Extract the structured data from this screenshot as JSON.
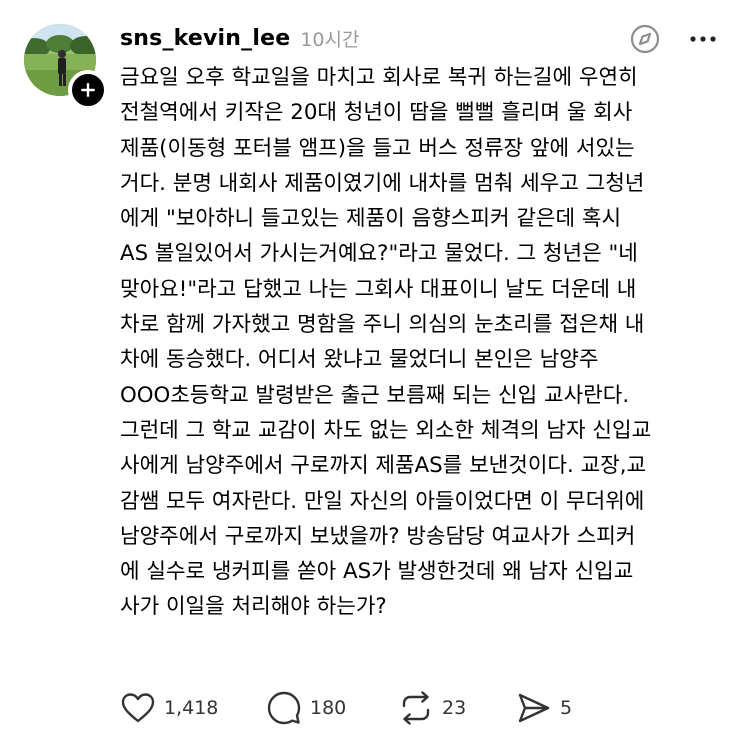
{
  "post": {
    "username": "sns_kevin_lee",
    "timestamp": "10시간",
    "body_lines": [
      "금요일 오후 학교일을 마치고 회사로 복귀 하는길에 우연히",
      "전철역에서 키작은 20대 청년이 땀을 뻘뻘 흘리며 울 회사",
      "제품(이동형 포터블 앰프)을 들고 버스 정류장 앞에 서있는",
      "거다. 분명 내회사 제품이였기에 내차를 멈춰 세우고 그청년",
      "에게 \"보아하니 들고있는 제품이 음향스피커 같은데 혹시",
      "AS 볼일있어서 가시는거예요?\"라고 물었다. 그 청년은 \"네",
      "맞아요!\"라고 답했고 나는 그회사 대표이니 날도 더운데 내",
      "차로 함께 가자했고 명함을 주니 의심의 눈초리를 접은채 내",
      "차에 동승했다. 어디서 왔냐고 물었더니 본인은 남양주",
      "OOO초등학교 발령받은 출근 보름째 되는 신입 교사란다.",
      "그런데 그 학교 교감이 차도 없는 외소한 체격의 남자 신입교",
      "사에게 남양주에서 구로까지 제품AS를 보낸것이다. 교장,교",
      "감쌤 모두 여자란다. 만일 자신의 아들이었다면 이 무더위에",
      "남양주에서 구로까지 보냈을까? 방송담당 여교사가 스피커",
      "에 실수로 냉커피를 쏟아 AS가 발생한것데 왜 남자 신입교",
      "사가 이일을 처리해야 하는가?"
    ],
    "actions": {
      "likes": "1,418",
      "replies": "180",
      "reposts": "23",
      "shares": "5"
    }
  },
  "icons": {
    "follow": "plus-icon",
    "translate": "compass-icon",
    "menu": "more-horizontal-icon",
    "like": "heart-icon",
    "reply": "comment-bubble-icon",
    "repost": "repost-arrows-icon",
    "share": "send-paper-plane-icon"
  },
  "colors": {
    "text": "#000000",
    "muted": "#9a9a9a",
    "icon": "#333333",
    "badge": "#000000"
  }
}
